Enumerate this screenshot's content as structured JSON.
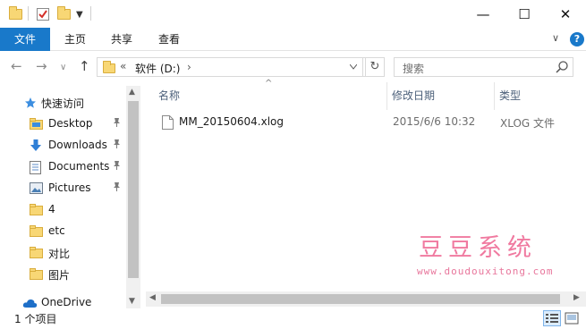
{
  "window": {
    "minimize_glyph": "—",
    "maximize_glyph": "☐",
    "close_glyph": "✕"
  },
  "ribbon": {
    "tabs": [
      "文件",
      "主页",
      "共享",
      "查看"
    ],
    "expand_glyph": "∨",
    "help_glyph": "?",
    "file_tab_color": "#1979ca"
  },
  "nav": {
    "back_glyph": "←",
    "forward_glyph": "→",
    "recent_glyph": "∨",
    "up_glyph": "↑",
    "address_overflow": "«",
    "address_path": "软件 (D:)",
    "address_chevron": "›",
    "refresh_glyph": "↻",
    "search_placeholder": "搜索"
  },
  "sidebar": {
    "quick_access_label": "快速访问",
    "items": [
      {
        "label": "Desktop",
        "icon": "folder-blue-icon",
        "pinned": true
      },
      {
        "label": "Downloads",
        "icon": "download-arrow-icon",
        "pinned": true
      },
      {
        "label": "Documents",
        "icon": "document-icon",
        "pinned": true
      },
      {
        "label": "Pictures",
        "icon": "pictures-icon",
        "pinned": true
      },
      {
        "label": "4",
        "icon": "folder-icon",
        "pinned": false
      },
      {
        "label": "etc",
        "icon": "folder-icon",
        "pinned": false
      },
      {
        "label": "对比",
        "icon": "folder-icon",
        "pinned": false
      },
      {
        "label": "图片",
        "icon": "folder-icon",
        "pinned": false
      }
    ],
    "onedrive_label": "OneDrive",
    "pin_glyph": "📌"
  },
  "columns": {
    "name": "名称",
    "modified": "修改日期",
    "type": "类型",
    "sort_glyph": "^"
  },
  "files": [
    {
      "name": "MM_20150604.xlog",
      "modified": "2015/6/6 10:32",
      "type": "XLOG 文件"
    }
  ],
  "watermark": {
    "title": "豆豆系统",
    "url": "www.doudouxitong.com",
    "color": "#f07aa0"
  },
  "status": {
    "item_count": "1 个项目"
  }
}
